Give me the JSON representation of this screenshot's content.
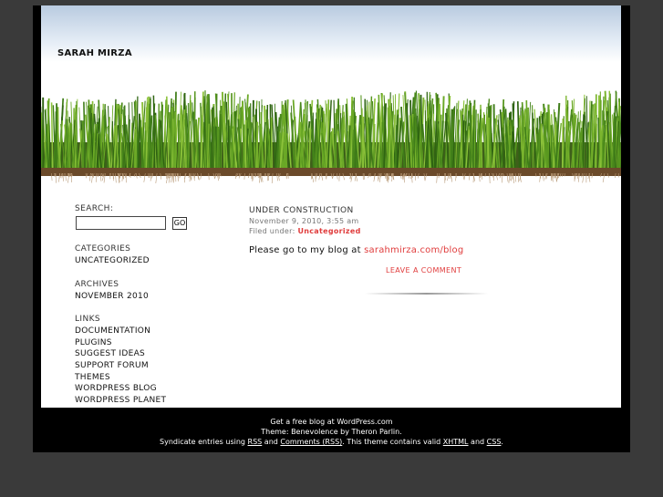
{
  "header": {
    "site_title": "SARAH MIRZA"
  },
  "sidebar": {
    "search_label": "SEARCH:",
    "search_value": "",
    "go_label": "GO",
    "categories_heading": "CATEGORIES",
    "categories": [
      "UNCATEGORIZED"
    ],
    "archives_heading": "ARCHIVES",
    "archives": [
      "NOVEMBER 2010"
    ],
    "links_heading": "LINKS",
    "links": [
      "DOCUMENTATION",
      "PLUGINS",
      "SUGGEST IDEAS",
      "SUPPORT FORUM",
      "THEMES",
      "WORDPRESS BLOG",
      "WORDPRESS PLANET"
    ]
  },
  "post": {
    "title": "UNDER CONSTRUCTION",
    "date": "November 9, 2010, 3:55 am",
    "filed_label": "Filed under: ",
    "category": "Uncategorized",
    "body_text": "Please go to my blog at ",
    "body_link": "sarahmirza.com/blog",
    "leave_comment": "LEAVE A COMMENT"
  },
  "footer": {
    "line1": "Get a free blog at WordPress.com",
    "line2": "Theme: Benevolence by Theron Parlin.",
    "syndicate_prefix": "Syndicate entries using ",
    "rss": "RSS",
    "and1": " and ",
    "comments_rss": "Comments (RSS)",
    "valid_text": ". This theme contains valid ",
    "xhtml": "XHTML",
    "and2": " and ",
    "css": "CSS",
    "end": "."
  },
  "colors": {
    "accent": "#e03c3c",
    "frame": "#000000",
    "background": "#3a3a3a"
  }
}
